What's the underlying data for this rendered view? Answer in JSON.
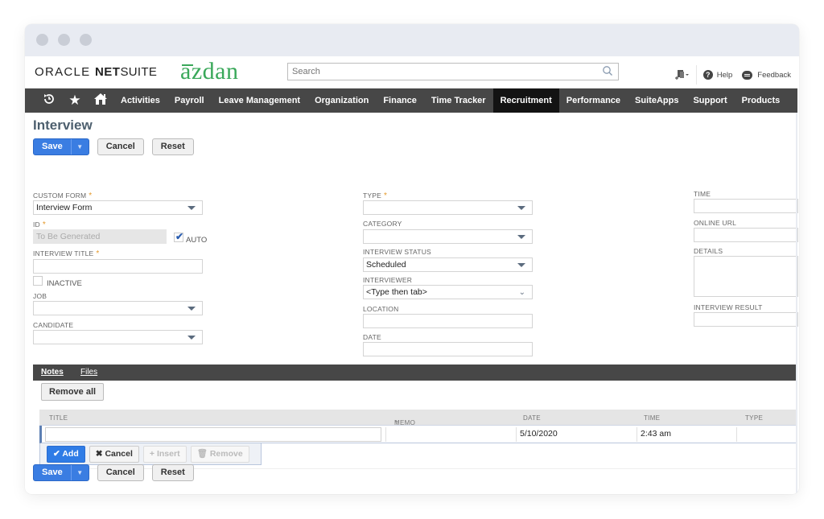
{
  "window": {
    "controls": [
      "close",
      "minimize",
      "maximize"
    ]
  },
  "header": {
    "brand_oracle": "ORACLE",
    "brand_net": "NET",
    "brand_suite": "SUITE",
    "company_logo": "azdan",
    "search_placeholder": "Search",
    "help_label": "Help",
    "feedback_label": "Feedback"
  },
  "nav": {
    "icons": [
      "recent-icon",
      "star-icon",
      "home-icon"
    ],
    "items": [
      {
        "label": "Activities",
        "active": false
      },
      {
        "label": "Payroll",
        "active": false
      },
      {
        "label": "Leave Management",
        "active": false
      },
      {
        "label": "Organization",
        "active": false
      },
      {
        "label": "Finance",
        "active": false
      },
      {
        "label": "Time Tracker",
        "active": false
      },
      {
        "label": "Recruitment",
        "active": true
      },
      {
        "label": "Performance",
        "active": false
      },
      {
        "label": "SuiteApps",
        "active": false
      },
      {
        "label": "Support",
        "active": false
      },
      {
        "label": "Products",
        "active": false
      }
    ]
  },
  "page": {
    "title": "Interview",
    "buttons": {
      "save": "Save",
      "cancel": "Cancel",
      "reset": "Reset"
    }
  },
  "form": {
    "custom_form": {
      "label": "CUSTOM FORM",
      "required": true,
      "value": "Interview Form"
    },
    "id": {
      "label": "ID",
      "required": true,
      "value": "To Be Generated",
      "auto_label": "AUTO",
      "auto_checked": true
    },
    "interview_title": {
      "label": "INTERVIEW TITLE",
      "required": true,
      "value": ""
    },
    "inactive": {
      "label": "INACTIVE",
      "checked": false
    },
    "job": {
      "label": "JOB",
      "value": ""
    },
    "candidate": {
      "label": "CANDIDATE",
      "value": ""
    },
    "type": {
      "label": "TYPE",
      "required": true,
      "value": ""
    },
    "category": {
      "label": "CATEGORY",
      "value": ""
    },
    "interview_status": {
      "label": "INTERVIEW STATUS",
      "value": "Scheduled"
    },
    "interviewer": {
      "label": "INTERVIEWER",
      "value": "<Type then tab>"
    },
    "location": {
      "label": "LOCATION",
      "value": ""
    },
    "date": {
      "label": "DATE",
      "value": ""
    },
    "time": {
      "label": "TIME",
      "value": ""
    },
    "online_url": {
      "label": "ONLINE URL",
      "value": ""
    },
    "details": {
      "label": "DETAILS",
      "value": ""
    },
    "interview_result": {
      "label": "INTERVIEW RESULT",
      "value": ""
    }
  },
  "subtabs": {
    "tabs": [
      {
        "label": "Notes",
        "active": true
      },
      {
        "label": "Files",
        "active": false
      }
    ],
    "remove_all": "Remove all"
  },
  "notes_grid": {
    "columns": [
      {
        "label": "TITLE",
        "required": false
      },
      {
        "label": "MEMO",
        "required": true
      },
      {
        "label": "DATE",
        "required": false
      },
      {
        "label": "TIME",
        "required": false
      },
      {
        "label": "TYPE",
        "required": false
      }
    ],
    "row": {
      "title": "",
      "memo": "",
      "date": "5/10/2020",
      "time": "2:43 am",
      "type": ""
    },
    "actions": {
      "add": "Add",
      "cancel": "Cancel",
      "insert": "Insert",
      "remove": "Remove"
    }
  },
  "colors": {
    "accent_blue": "#3a7de2",
    "nav_bg": "#474747",
    "nav_active": "#131313",
    "brand_green": "#3aa85a",
    "required_star": "#e59a2c"
  }
}
